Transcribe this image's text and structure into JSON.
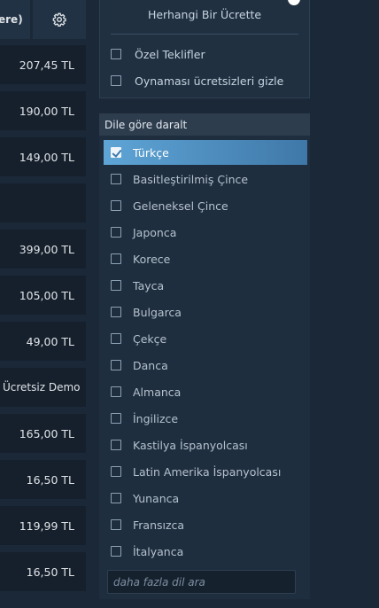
{
  "results_header": {
    "sort_label": "ere)",
    "settings_icon": "gear-icon"
  },
  "results": [
    {
      "price": "207,45 TL"
    },
    {
      "price": "190,00 TL"
    },
    {
      "price": "149,00 TL"
    },
    {
      "price": ""
    },
    {
      "price": "399,00 TL"
    },
    {
      "price": "105,00 TL"
    },
    {
      "price": "49,00 TL"
    },
    {
      "price": "Ücretsiz Demo"
    },
    {
      "price": "165,00 TL"
    },
    {
      "price": "16,50 TL"
    },
    {
      "price": "119,99 TL"
    },
    {
      "price": "16,50 TL"
    }
  ],
  "price_filter": {
    "value_label": "Herhangi Bir Ücrette",
    "special_offers_label": "Özel Teklifler",
    "hide_free_label": "Oynaması ücretsizleri gizle"
  },
  "language_filter": {
    "header": "Dile göre daralt",
    "languages": [
      {
        "label": "Türkçe",
        "checked": true
      },
      {
        "label": "Basitleştirilmiş Çince",
        "checked": false
      },
      {
        "label": "Geleneksel Çince",
        "checked": false
      },
      {
        "label": "Japonca",
        "checked": false
      },
      {
        "label": "Korece",
        "checked": false
      },
      {
        "label": "Tayca",
        "checked": false
      },
      {
        "label": "Bulgarca",
        "checked": false
      },
      {
        "label": "Çekçe",
        "checked": false
      },
      {
        "label": "Danca",
        "checked": false
      },
      {
        "label": "Almanca",
        "checked": false
      },
      {
        "label": "İngilizce",
        "checked": false
      },
      {
        "label": "Kastilya İspanyolcası",
        "checked": false
      },
      {
        "label": "Latin Amerika İspanyolcası",
        "checked": false
      },
      {
        "label": "Yunanca",
        "checked": false
      },
      {
        "label": "Fransızca",
        "checked": false
      },
      {
        "label": "İtalyanca",
        "checked": false
      }
    ],
    "search_placeholder": "daha fazla dil ara"
  },
  "colors": {
    "page_bg": "#1b2838",
    "selected_gradient_start": "#5ea5d6",
    "selected_gradient_end": "#3f78a8"
  }
}
